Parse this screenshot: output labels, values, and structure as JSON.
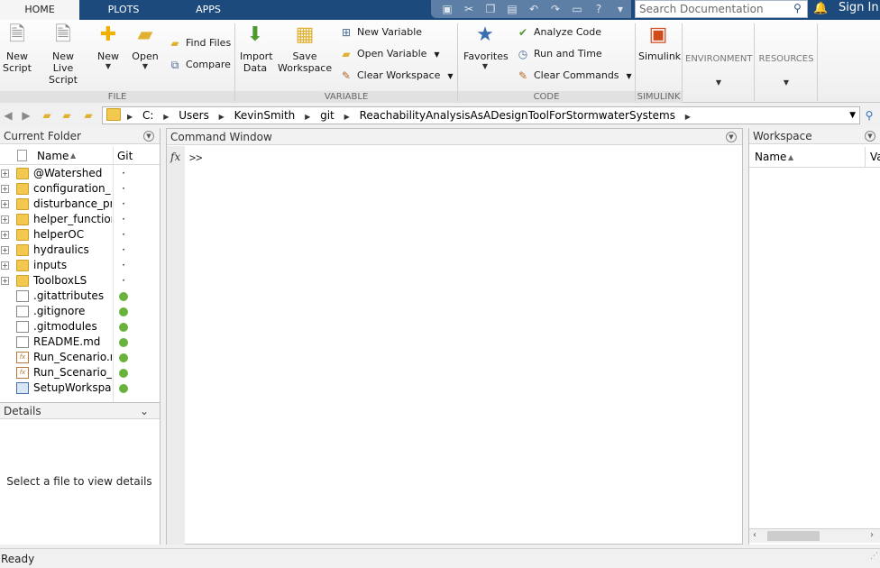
{
  "tabs": [
    {
      "label": "HOME",
      "active": true
    },
    {
      "label": "PLOTS",
      "active": false
    },
    {
      "label": "APPS",
      "active": false
    }
  ],
  "quick_access": [
    "save-icon",
    "cut-icon",
    "copy-icon",
    "paste-icon",
    "undo-icon",
    "redo-icon",
    "switch-windows-icon",
    "help-icon",
    "more-icon"
  ],
  "search": {
    "placeholder": "Search Documentation"
  },
  "signin_label": "Sign In",
  "ribbon": {
    "file": {
      "label": "FILE",
      "new_script": "New\nScript",
      "new_live_script": "New\nLive Script",
      "new": "New",
      "open": "Open",
      "find_files": "Find Files",
      "compare": "Compare"
    },
    "variable": {
      "label": "VARIABLE",
      "import_data": "Import\nData",
      "save_workspace": "Save\nWorkspace",
      "new_variable": "New Variable",
      "open_variable": "Open Variable",
      "clear_workspace": "Clear Workspace"
    },
    "code": {
      "label": "CODE",
      "favorites": "Favorites",
      "analyze_code": "Analyze Code",
      "run_and_time": "Run and Time",
      "clear_commands": "Clear Commands"
    },
    "simulink": {
      "label": "SIMULINK",
      "simulink": "Simulink"
    },
    "environment": "ENVIRONMENT",
    "resources": "RESOURCES"
  },
  "path": {
    "crumbs": [
      "C:",
      "Users",
      "KevinSmith",
      "git",
      "ReachabilityAnalysisAsADesignToolForStormwaterSystems"
    ]
  },
  "current_folder": {
    "title": "Current Folder",
    "col_name": "Name",
    "col_git": "Git",
    "items": [
      {
        "name": "@Watershed",
        "kind": "folder",
        "expand": true,
        "git": "·"
      },
      {
        "name": "configuration_...",
        "kind": "folder",
        "expand": true,
        "git": "·"
      },
      {
        "name": "disturbance_pr...",
        "kind": "folder",
        "expand": true,
        "git": "·"
      },
      {
        "name": "helper_functions",
        "kind": "folder",
        "expand": true,
        "git": "·"
      },
      {
        "name": "helperOC",
        "kind": "folder",
        "expand": true,
        "git": "·"
      },
      {
        "name": "hydraulics",
        "kind": "folder",
        "expand": true,
        "git": "·"
      },
      {
        "name": "inputs",
        "kind": "folder",
        "expand": true,
        "git": "·"
      },
      {
        "name": "ToolboxLS",
        "kind": "folder",
        "expand": true,
        "git": "·"
      },
      {
        "name": ".gitattributes",
        "kind": "file",
        "expand": false,
        "git": "dot"
      },
      {
        "name": ".gitignore",
        "kind": "file",
        "expand": false,
        "git": "dot"
      },
      {
        "name": ".gitmodules",
        "kind": "file",
        "expand": false,
        "git": "dot"
      },
      {
        "name": "README.md",
        "kind": "file",
        "expand": false,
        "git": "dot"
      },
      {
        "name": "Run_Scenario.m",
        "kind": "mfile",
        "expand": false,
        "git": "dot"
      },
      {
        "name": "Run_Scenario_...",
        "kind": "mfile",
        "expand": false,
        "git": "dot"
      },
      {
        "name": "SetupWorkspa...",
        "kind": "mat",
        "expand": false,
        "git": "dot"
      }
    ]
  },
  "details": {
    "title": "Details",
    "message": "Select a file to view details"
  },
  "command_window": {
    "title": "Command Window",
    "prompt": ">>"
  },
  "workspace": {
    "title": "Workspace",
    "col_name": "Name",
    "col_value": "Va"
  },
  "status": "Ready",
  "colors": {
    "tabbar": "#1d4a7c",
    "git_ok": "#6ab23e",
    "folder": "#f3c84f"
  }
}
